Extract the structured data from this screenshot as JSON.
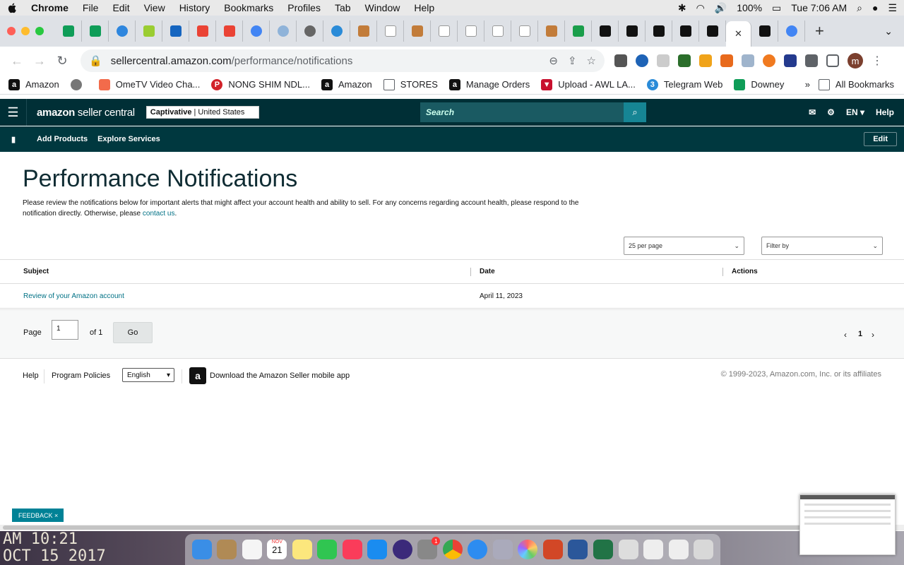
{
  "menubar": {
    "app": "Chrome",
    "items": [
      "File",
      "Edit",
      "View",
      "History",
      "Bookmarks",
      "Profiles",
      "Tab",
      "Window",
      "Help"
    ],
    "battery": "100%",
    "clock": "Tue 7:06 AM"
  },
  "omnibox": {
    "host": "sellercentral.amazon.com",
    "path": "/performance/notifications"
  },
  "profile_initial": "m",
  "bookmarks": [
    "Amazon",
    "OmeTV Video Cha...",
    "NONG SHIM NDL...",
    "Amazon",
    "STORES",
    "Manage Orders",
    "Upload - AWL LA...",
    "Telegram Web",
    "Downey"
  ],
  "bookmarks_more": "»",
  "all_bookmarks": "All Bookmarks",
  "seller_central": {
    "logo_bold": "amazon",
    "logo_rest": " seller central",
    "store_name": "Captivative",
    "store_region": "| United States",
    "search_placeholder": "Search",
    "lang": "EN",
    "help": "Help",
    "subnav": [
      "Add Products",
      "Explore Services"
    ],
    "edit": "Edit"
  },
  "page": {
    "title": "Performance Notifications",
    "intro": "Please review the notifications below for important alerts that might affect your account health and ability to sell. For any concerns regarding account health, please respond to the notification directly. Otherwise, please ",
    "intro_link": "contact us",
    "intro_end": ".",
    "per_page": "25 per page",
    "filter": "Filter by"
  },
  "table": {
    "headers": [
      "Subject",
      "Date",
      "Actions"
    ],
    "rows": [
      {
        "subject": "Review of your Amazon account",
        "date": "April 11, 2023"
      }
    ]
  },
  "pager": {
    "page_label": "Page",
    "page_value": "1",
    "of_label": "of 1",
    "go": "Go",
    "current": "1"
  },
  "footer": {
    "help": "Help",
    "policies": "Program Policies",
    "language": "English",
    "app_text": "Download the Amazon Seller mobile app",
    "copyright": "© 1999-2023, Amazon.com, Inc. or its affiliates"
  },
  "feedback": "FEEDBACK ×",
  "desktop_clock_line1": "AM 10:21",
  "desktop_clock_line2": "OCT 15 2017",
  "dock_calendar_month": "NOV",
  "dock_calendar_day": "21",
  "dock_badge": "1",
  "colors": {
    "header_bg": "#002f36",
    "subnav_bg": "#00383f",
    "link": "#007185",
    "feedback": "#008296"
  }
}
